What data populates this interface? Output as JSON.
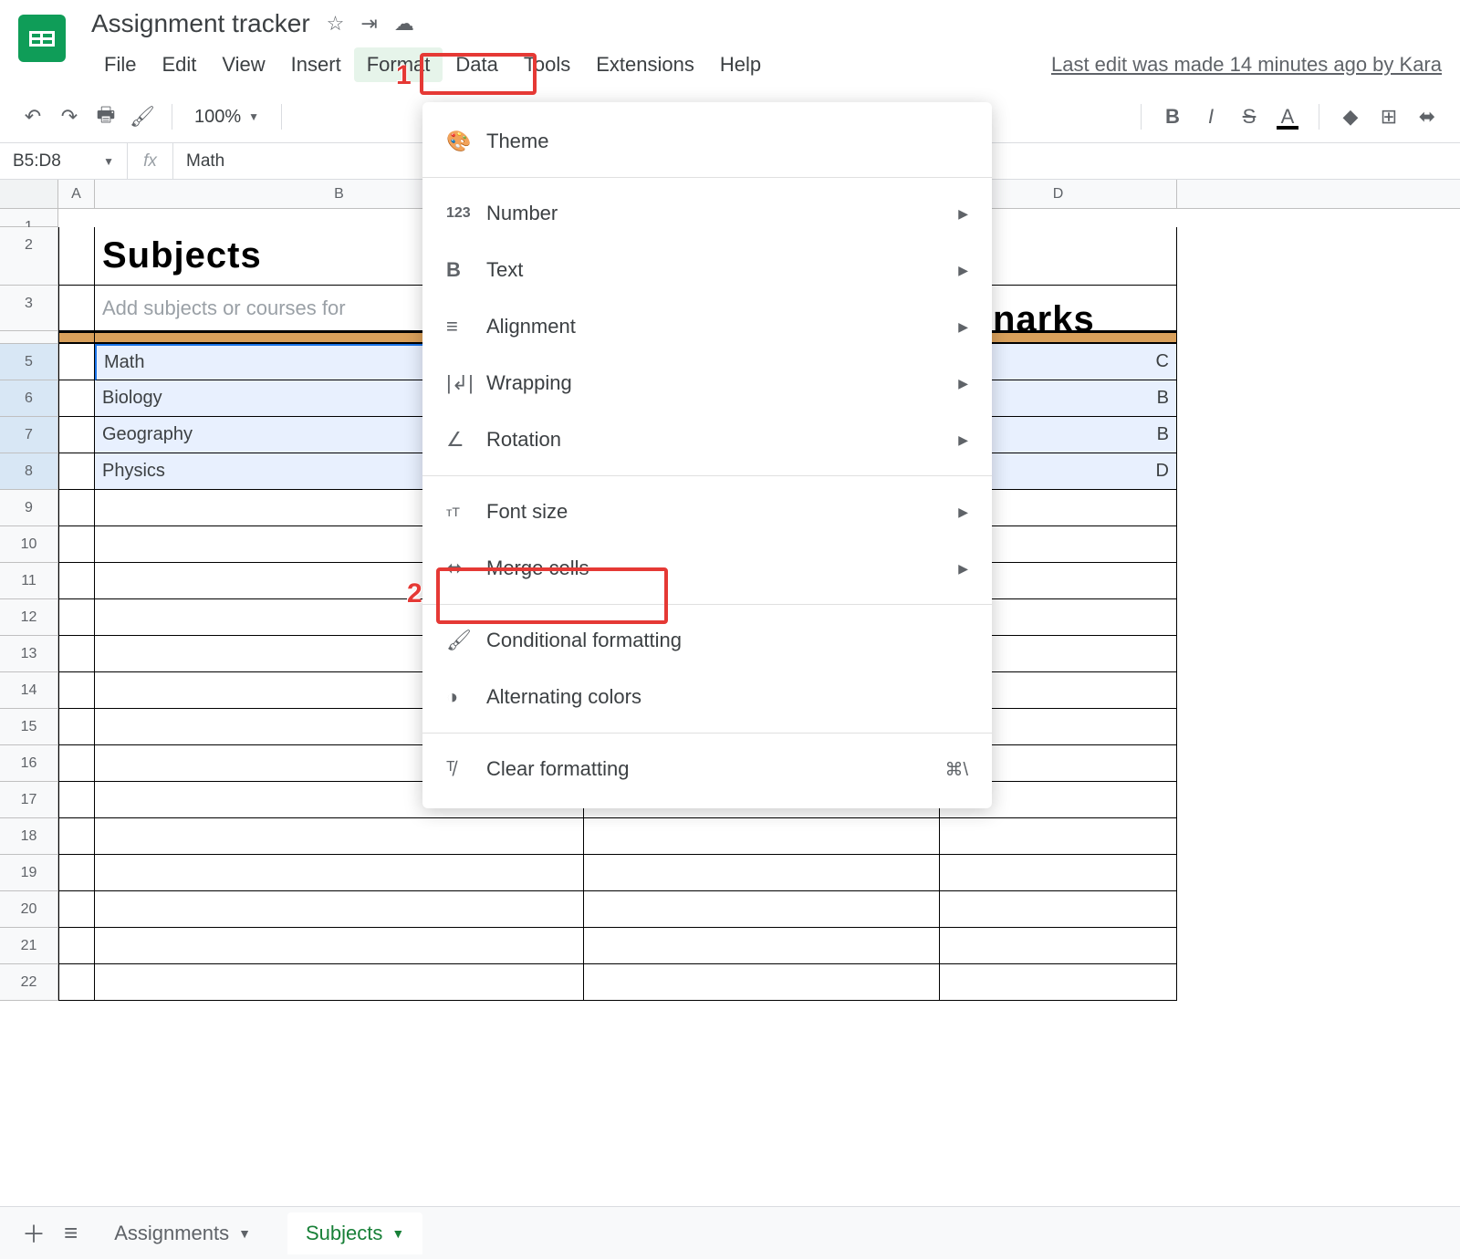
{
  "doc": {
    "title": "Assignment tracker"
  },
  "menubar": {
    "items": [
      "File",
      "Edit",
      "View",
      "Insert",
      "Format",
      "Data",
      "Tools",
      "Extensions",
      "Help"
    ],
    "last_edit": "Last edit was made 14 minutes ago by Kara"
  },
  "toolbar": {
    "zoom": "100%"
  },
  "formula": {
    "name_box": "B5:D8",
    "fx_label": "fx",
    "input": "Math"
  },
  "dropdown": {
    "items": [
      {
        "icon": "🎨",
        "label": "Theme",
        "arrow": false
      },
      {
        "sep": true
      },
      {
        "icon": "123",
        "label": "Number",
        "arrow": true
      },
      {
        "icon": "B",
        "label": "Text",
        "arrow": true
      },
      {
        "icon": "≡",
        "label": "Alignment",
        "arrow": true
      },
      {
        "icon": "|↲|",
        "label": "Wrapping",
        "arrow": true
      },
      {
        "icon": "∠",
        "label": "Rotation",
        "arrow": true
      },
      {
        "sep": true
      },
      {
        "icon": "ᴛT",
        "label": "Font size",
        "arrow": true
      },
      {
        "icon": "⬌",
        "label": "Merge cells",
        "arrow": true
      },
      {
        "sep": true
      },
      {
        "icon": "🖌",
        "label": "Conditional formatting",
        "arrow": false
      },
      {
        "icon": "◑",
        "label": "Alternating colors",
        "arrow": false
      },
      {
        "sep": true
      },
      {
        "icon": "⊘",
        "label": "Clear formatting",
        "arrow": false,
        "shortcut": "⌘\\"
      }
    ]
  },
  "annotations": {
    "num1": "1",
    "num2": "2"
  },
  "columns": [
    "A",
    "B",
    "",
    "D"
  ],
  "sheet": {
    "title": "Subjects",
    "marks_label": "narks",
    "hint": "Add subjects or courses for",
    "rows": [
      {
        "b": "Math",
        "d": "C"
      },
      {
        "b": "Biology",
        "d": "B"
      },
      {
        "b": "Geography",
        "d": "B"
      },
      {
        "b": "Physics",
        "d": "D"
      }
    ]
  },
  "tabs": {
    "items": [
      {
        "label": "Assignments",
        "active": false
      },
      {
        "label": "Subjects",
        "active": true
      }
    ]
  }
}
